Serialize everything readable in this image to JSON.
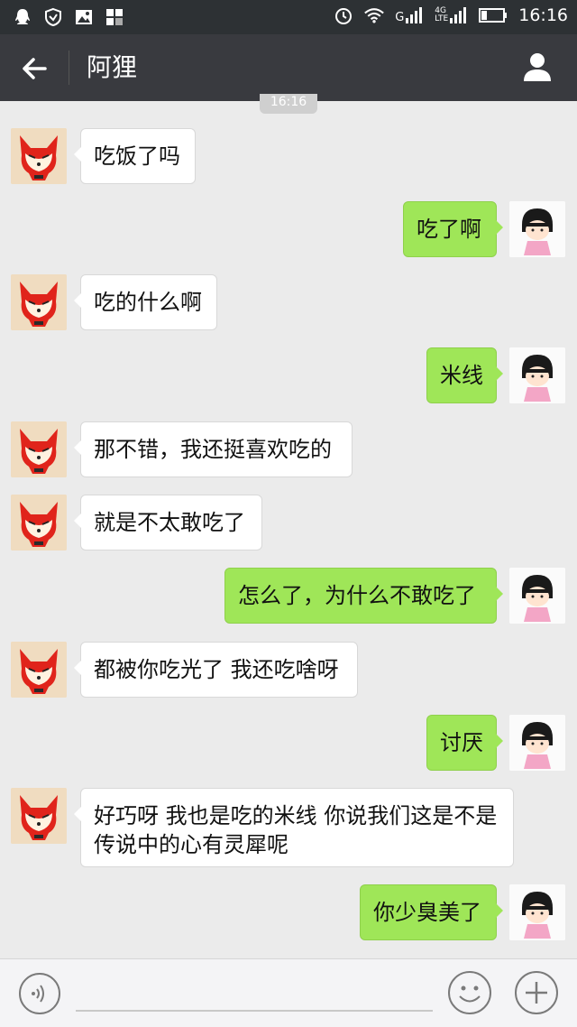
{
  "status_bar": {
    "time": "16:16",
    "network_g": "G",
    "network_4g": "4G",
    "network_lte": "LTE"
  },
  "header": {
    "title": "阿狸"
  },
  "time_badge": "16:16",
  "messages": [
    {
      "side": "in",
      "text": "吃饭了吗"
    },
    {
      "side": "out",
      "text": "吃了啊"
    },
    {
      "side": "in",
      "text": "吃的什么啊"
    },
    {
      "side": "out",
      "text": "米线"
    },
    {
      "side": "in",
      "text": "那不错，我还挺喜欢吃的"
    },
    {
      "side": "in",
      "text": "就是不太敢吃了"
    },
    {
      "side": "out",
      "text": "怎么了，为什么不敢吃了"
    },
    {
      "side": "in",
      "text": "都被你吃光了 我还吃啥呀"
    },
    {
      "side": "out",
      "text": "讨厌"
    },
    {
      "side": "in",
      "text": "好巧呀 我也是吃的米线 你说我们这是不是传说中的心有灵犀呢"
    },
    {
      "side": "out",
      "text": "你少臭美了"
    }
  ],
  "input": {
    "placeholder": ""
  },
  "colors": {
    "title_bar": "#393a3f",
    "status_bar": "#2d3134",
    "background": "#ebebeb",
    "outgoing_bubble": "#9fe658",
    "incoming_bubble": "#ffffff"
  },
  "icons": {
    "back": "back-arrow-icon",
    "profile": "person-icon",
    "voice": "voice-icon",
    "emoji": "emoji-icon",
    "plus": "plus-icon"
  }
}
